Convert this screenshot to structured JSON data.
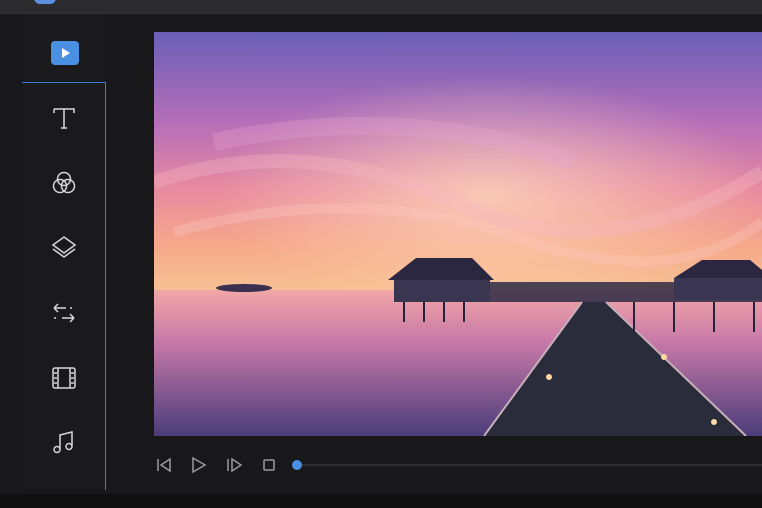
{
  "colors": {
    "accent": "#4a90e2",
    "background": "#18181a",
    "sidebar": "#1a1a1c",
    "icon": "#d7d7d9"
  },
  "sidebar": {
    "items": [
      {
        "name": "video",
        "icon": "video-play-icon",
        "active": true
      },
      {
        "name": "text",
        "icon": "text-icon"
      },
      {
        "name": "filters",
        "icon": "filter-circles-icon"
      },
      {
        "name": "overlays",
        "icon": "layers-icon"
      },
      {
        "name": "transitions",
        "icon": "transition-arrows-icon"
      },
      {
        "name": "elements",
        "icon": "film-icon"
      },
      {
        "name": "music",
        "icon": "music-note-icon"
      }
    ]
  },
  "preview": {
    "image": "sunset-over-water-villas-photo"
  },
  "playback": {
    "controls": [
      "previous-frame-icon",
      "play-icon",
      "next-frame-icon",
      "stop-icon"
    ],
    "progress": 0.0
  }
}
